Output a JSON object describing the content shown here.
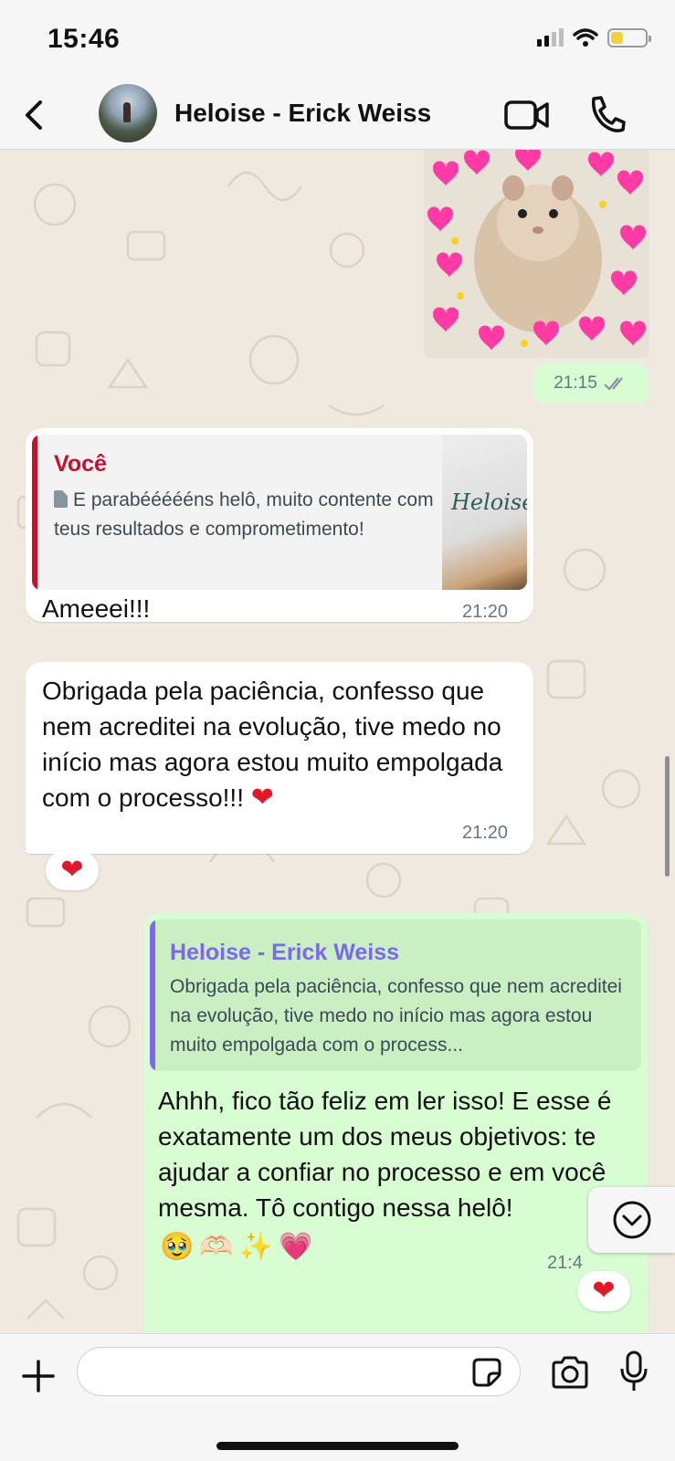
{
  "status_bar": {
    "time": "15:46"
  },
  "header": {
    "contact_name": "Heloise - Erick Weiss"
  },
  "messages": {
    "image_message": {
      "time": "21:15"
    },
    "reply_message": {
      "quote_author": "Você",
      "quote_text": "E parabéééééns helô, muito contente com teus resultados e comprometimento!",
      "quote_thumb_text": "Heloise",
      "text": "Ameeei!!!",
      "time": "21:20"
    },
    "long_message": {
      "text": "Obrigada pela paciência, confesso que nem acreditei na evolução, tive medo no início mas agora estou muito empolgada com o processo!!!",
      "emoji": "❤️",
      "time": "21:20",
      "reaction": "❤️"
    },
    "outgoing_reply": {
      "quote_author": "Heloise - Erick Weiss",
      "quote_text": "Obrigada pela paciência, confesso que nem acreditei na evolução, tive medo no início mas agora estou muito empolgada com o process...",
      "text": "Ahhh, fico tão feliz em ler isso! E esse é exatamente um dos meus objetivos: te ajudar a confiar no processo e em você mesma. Tô contigo nessa helô!",
      "emojis": "🥹🫶🏻✨💗",
      "time": "21:4",
      "reaction": "❤️"
    }
  },
  "colors": {
    "outgoing_bubble": "#d9fdd3",
    "incoming_bubble": "#ffffff",
    "quote_you": "#c8102e",
    "quote_contact": "#7b68ee",
    "timestamp": "#667781"
  },
  "icons": [
    "back-icon",
    "video-call-icon",
    "phone-icon",
    "double-check-icon",
    "document-icon",
    "chevron-down-icon",
    "plus-icon",
    "sticker-icon",
    "camera-icon",
    "microphone-icon"
  ]
}
